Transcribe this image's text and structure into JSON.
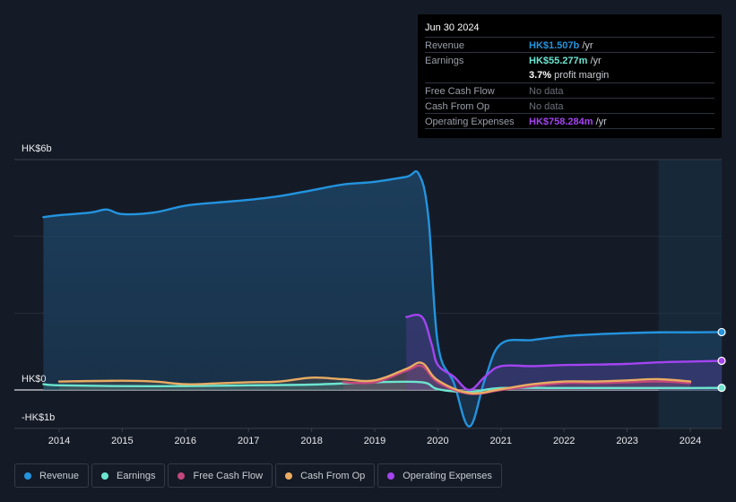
{
  "tooltip": {
    "date": "Jun 30 2024",
    "rows": [
      {
        "label": "Revenue",
        "value": "HK$1.507b",
        "unit": " /yr",
        "color": "#2394df"
      },
      {
        "label": "Earnings",
        "value": "HK$55.277m",
        "unit": " /yr",
        "color": "#6ce5cf"
      },
      {
        "label": "",
        "value": "3.7%",
        "unit": " profit margin",
        "color": "#ffffff"
      },
      {
        "label": "Free Cash Flow",
        "value": "No data",
        "unit": "",
        "color": "#6b6f78"
      },
      {
        "label": "Cash From Op",
        "value": "No data",
        "unit": "",
        "color": "#6b6f78"
      },
      {
        "label": "Operating Expenses",
        "value": "HK$758.284m",
        "unit": " /yr",
        "color": "#a444f1"
      }
    ]
  },
  "legend": [
    {
      "label": "Revenue",
      "color": "#2394df"
    },
    {
      "label": "Earnings",
      "color": "#6ce5cf"
    },
    {
      "label": "Free Cash Flow",
      "color": "#c4467d"
    },
    {
      "label": "Cash From Op",
      "color": "#e9ac63"
    },
    {
      "label": "Operating Expenses",
      "color": "#a444f1"
    }
  ],
  "chart_data": {
    "type": "area",
    "title": "",
    "xlabel": "",
    "ylabel": "",
    "y_unit": "HK$ billions",
    "ylim": [
      -1,
      6
    ],
    "xlim": [
      2013.3,
      2024.5
    ],
    "y_tick_labels": [
      {
        "value": 6,
        "label": "HK$6b"
      },
      {
        "value": 0,
        "label": "HK$0"
      },
      {
        "value": -1,
        "label": "-HK$1b"
      }
    ],
    "gridlines": [
      6,
      4,
      2,
      0
    ],
    "x_ticks": [
      2014,
      2015,
      2016,
      2017,
      2018,
      2019,
      2020,
      2021,
      2022,
      2023,
      2024
    ],
    "forecast_shade_start": 2023.5,
    "grid": true,
    "legend_position": "bottom-left",
    "series": [
      {
        "name": "Revenue",
        "color": "#2394df",
        "x": [
          2013.75,
          2014.0,
          2014.5,
          2014.75,
          2015.0,
          2015.5,
          2016.0,
          2016.5,
          2017.0,
          2017.5,
          2018.0,
          2018.5,
          2019.0,
          2019.5,
          2019.7,
          2019.85,
          2020.0,
          2020.25,
          2020.5,
          2020.75,
          2021.0,
          2021.5,
          2022.0,
          2022.5,
          2023.0,
          2023.5,
          2024.0,
          2024.5
        ],
        "y": [
          4.5,
          4.55,
          4.62,
          4.7,
          4.58,
          4.62,
          4.8,
          4.88,
          4.95,
          5.05,
          5.2,
          5.35,
          5.42,
          5.55,
          5.62,
          4.5,
          1.2,
          0.2,
          -0.95,
          0.3,
          1.2,
          1.3,
          1.4,
          1.45,
          1.48,
          1.5,
          1.5,
          1.507
        ]
      },
      {
        "name": "Earnings",
        "color": "#6ce5cf",
        "x": [
          2013.75,
          2014.0,
          2015.0,
          2016.0,
          2017.0,
          2018.0,
          2019.0,
          2019.75,
          2020.0,
          2020.5,
          2021.0,
          2022.0,
          2023.0,
          2024.0,
          2024.5
        ],
        "y": [
          0.15,
          0.12,
          0.1,
          0.1,
          0.12,
          0.14,
          0.2,
          0.2,
          0.02,
          -0.05,
          0.05,
          0.05,
          0.05,
          0.05,
          0.055
        ]
      },
      {
        "name": "Free Cash Flow",
        "color": "#c4467d",
        "x": [
          2018.5,
          2019.0,
          2019.5,
          2019.75,
          2020.0,
          2020.5,
          2021.0,
          2021.5,
          2022.0,
          2022.5,
          2023.0,
          2023.5,
          2024.0
        ],
        "y": [
          0.2,
          0.2,
          0.5,
          0.62,
          0.2,
          -0.1,
          0.0,
          0.1,
          0.18,
          0.18,
          0.2,
          0.22,
          0.18
        ]
      },
      {
        "name": "Cash From Op",
        "color": "#e9ac63",
        "x": [
          2014.0,
          2015.0,
          2015.5,
          2016.0,
          2016.5,
          2017.0,
          2017.5,
          2018.0,
          2018.5,
          2019.0,
          2019.5,
          2019.75,
          2020.0,
          2020.5,
          2021.0,
          2021.5,
          2022.0,
          2022.5,
          2023.0,
          2023.5,
          2024.0
        ],
        "y": [
          0.22,
          0.24,
          0.22,
          0.15,
          0.17,
          0.2,
          0.22,
          0.32,
          0.28,
          0.25,
          0.55,
          0.7,
          0.25,
          -0.08,
          0.02,
          0.15,
          0.22,
          0.22,
          0.25,
          0.28,
          0.22
        ]
      },
      {
        "name": "Operating Expenses",
        "color": "#a444f1",
        "x": [
          2019.5,
          2019.75,
          2019.9,
          2020.0,
          2020.25,
          2020.5,
          2020.75,
          2021.0,
          2021.5,
          2022.0,
          2022.5,
          2023.0,
          2023.5,
          2024.0,
          2024.5
        ],
        "y": [
          1.9,
          1.9,
          1.2,
          0.65,
          0.35,
          0.0,
          0.35,
          0.62,
          0.62,
          0.65,
          0.66,
          0.68,
          0.72,
          0.74,
          0.758
        ]
      }
    ]
  }
}
